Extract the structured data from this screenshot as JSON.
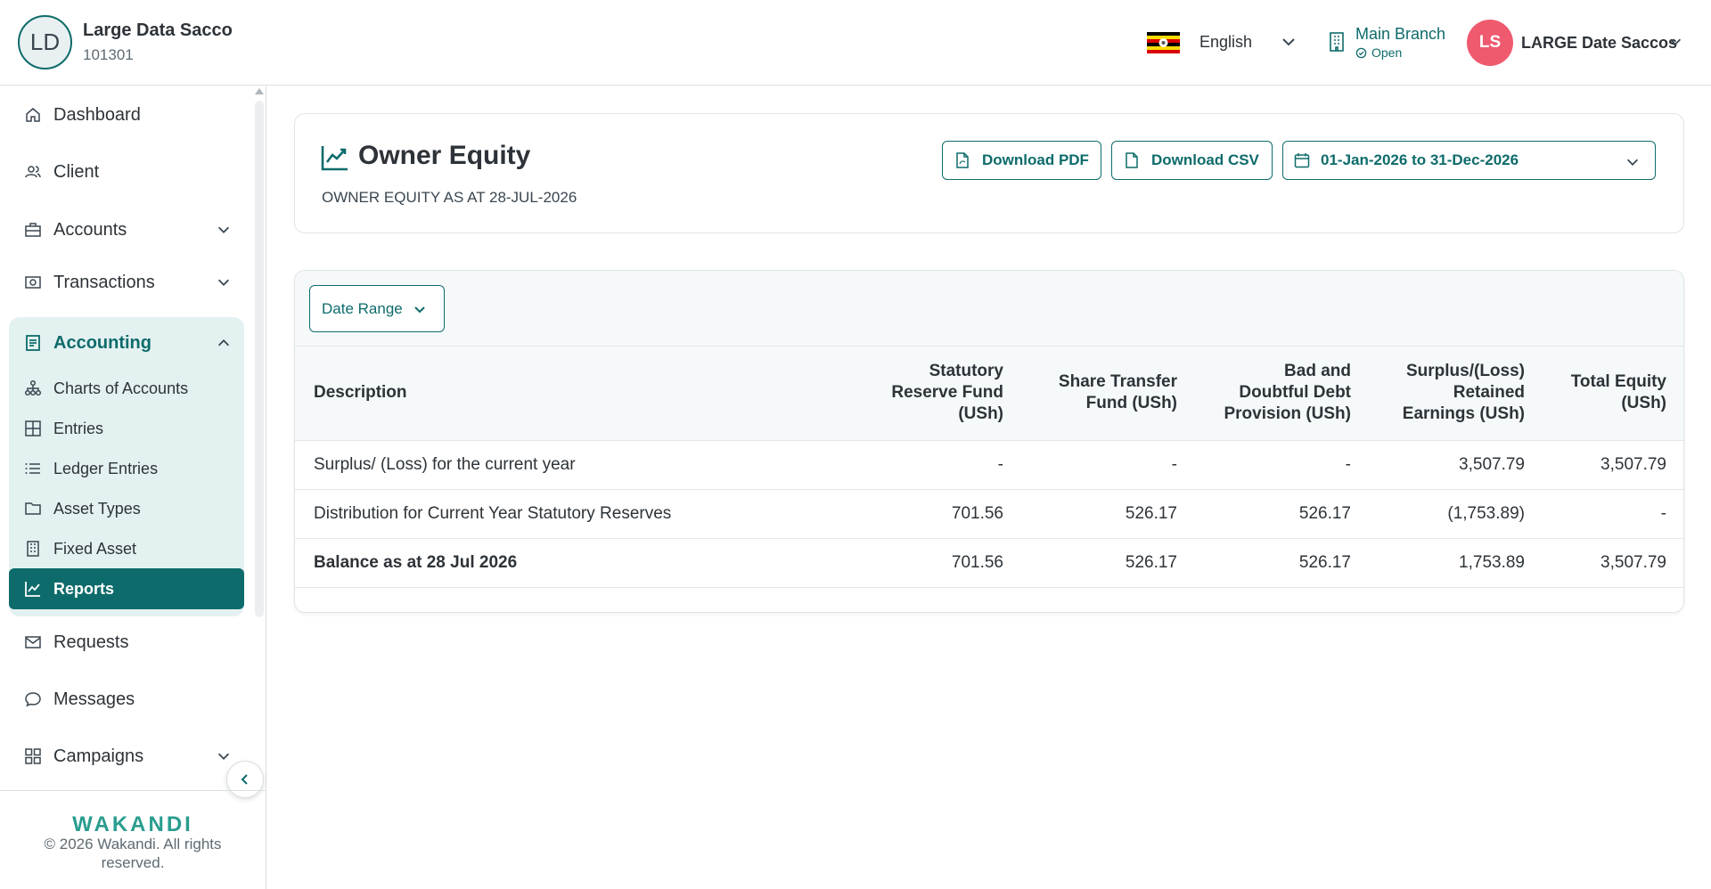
{
  "org": {
    "initials": "LD",
    "name": "Large Data Sacco",
    "code": "101301"
  },
  "header": {
    "language": "English",
    "branch": {
      "name": "Main Branch",
      "status": "Open"
    },
    "user": {
      "initials": "LS",
      "name": "LARGE Date Saccos"
    }
  },
  "sidebar": {
    "items": [
      {
        "label": "Dashboard",
        "icon": "home-icon"
      },
      {
        "label": "Client",
        "icon": "users-icon"
      },
      {
        "label": "Accounts",
        "icon": "briefcase-icon"
      },
      {
        "label": "Transactions",
        "icon": "cash-icon"
      }
    ],
    "accounting": {
      "label": "Accounting",
      "sub": [
        {
          "label": "Charts of Accounts",
          "icon": "hierarchy-icon"
        },
        {
          "label": "Entries",
          "icon": "grid-icon"
        },
        {
          "label": "Ledger Entries",
          "icon": "list-icon"
        },
        {
          "label": "Asset Types",
          "icon": "folder-icon"
        },
        {
          "label": "Fixed Asset",
          "icon": "building-icon"
        },
        {
          "label": "Reports",
          "icon": "chart-icon"
        }
      ]
    },
    "bottom_items": [
      {
        "label": "Requests",
        "icon": "mail-icon"
      },
      {
        "label": "Messages",
        "icon": "chat-icon"
      },
      {
        "label": "Campaigns",
        "icon": "apps-icon"
      }
    ],
    "brand": "WAKANDI",
    "copyright": "© 2026 Wakandi. All rights reserved."
  },
  "page": {
    "title": "Owner Equity",
    "subtitle": "OWNER EQUITY AS AT 28-JUL-2026",
    "download_pdf": "Download PDF",
    "download_csv": "Download CSV",
    "date_range_value": "01-Jan-2026 to 31-Dec-2026",
    "filter_label": "Date Range"
  },
  "table": {
    "headers": [
      "Description",
      "Statutory Reserve Fund (USh)",
      "Share Transfer Fund (USh)",
      "Bad and Doubtful Debt Provision (USh)",
      "Surplus/(Loss) Retained Earnings (USh)",
      "Total Equity (USh)"
    ],
    "rows": [
      [
        "Surplus/ (Loss) for the current year",
        "-",
        "-",
        "-",
        "3,507.79",
        "3,507.79"
      ],
      [
        "Distribution for Current Year Statutory Reserves",
        "701.56",
        "526.17",
        "526.17",
        "(1,753.89)",
        "-"
      ],
      [
        "Balance as at 28 Jul 2026",
        "701.56",
        "526.17",
        "526.17",
        "1,753.89",
        "3,507.79"
      ]
    ]
  },
  "colors": {
    "primary": "#0e6b6b",
    "accent_bg": "#e4f1f1",
    "avatar": "#ef5a6f",
    "brand": "#2a9d8f"
  }
}
